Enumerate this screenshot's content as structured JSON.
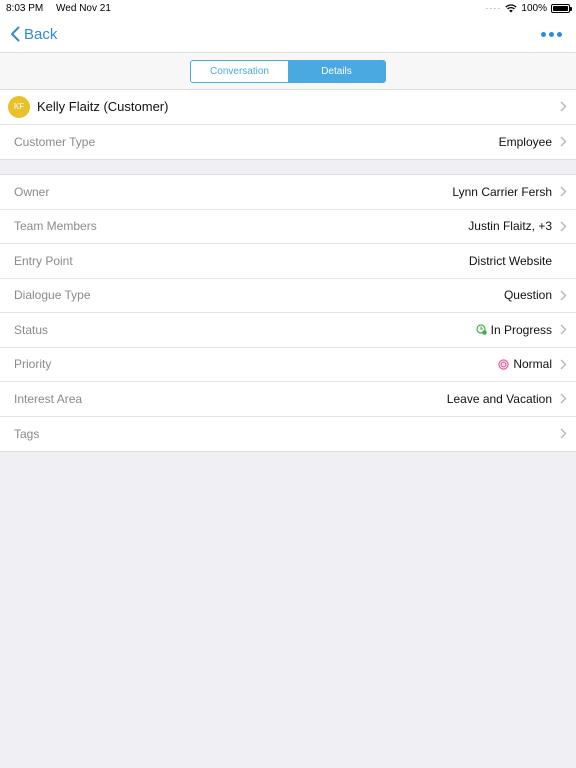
{
  "status_bar": {
    "time": "8:03 PM",
    "date": "Wed Nov 21",
    "battery": "100%"
  },
  "nav": {
    "back_label": "Back"
  },
  "segments": {
    "conversation": "Conversation",
    "details": "Details"
  },
  "customer": {
    "initials": "KF",
    "name": "Kelly Flaitz (Customer)"
  },
  "customer_type": {
    "label": "Customer Type",
    "value": "Employee"
  },
  "details": {
    "owner": {
      "label": "Owner",
      "value": "Lynn Carrier Fersh"
    },
    "team_members": {
      "label": "Team Members",
      "value": "Justin Flaitz, +3"
    },
    "entry_point": {
      "label": "Entry Point",
      "value": "District Website"
    },
    "dialogue_type": {
      "label": "Dialogue Type",
      "value": "Question"
    },
    "status": {
      "label": "Status",
      "value": "In Progress",
      "icon": "in-progress-icon",
      "color": "#3db24a"
    },
    "priority": {
      "label": "Priority",
      "value": "Normal",
      "icon": "priority-normal-icon",
      "color": "#e9548f"
    },
    "interest_area": {
      "label": "Interest Area",
      "value": "Leave and Vacation"
    },
    "tags": {
      "label": "Tags",
      "value": ""
    }
  },
  "colors": {
    "accent": "#2f8bd8",
    "segment": "#4aa9e0",
    "avatar": "#e9c12d"
  }
}
